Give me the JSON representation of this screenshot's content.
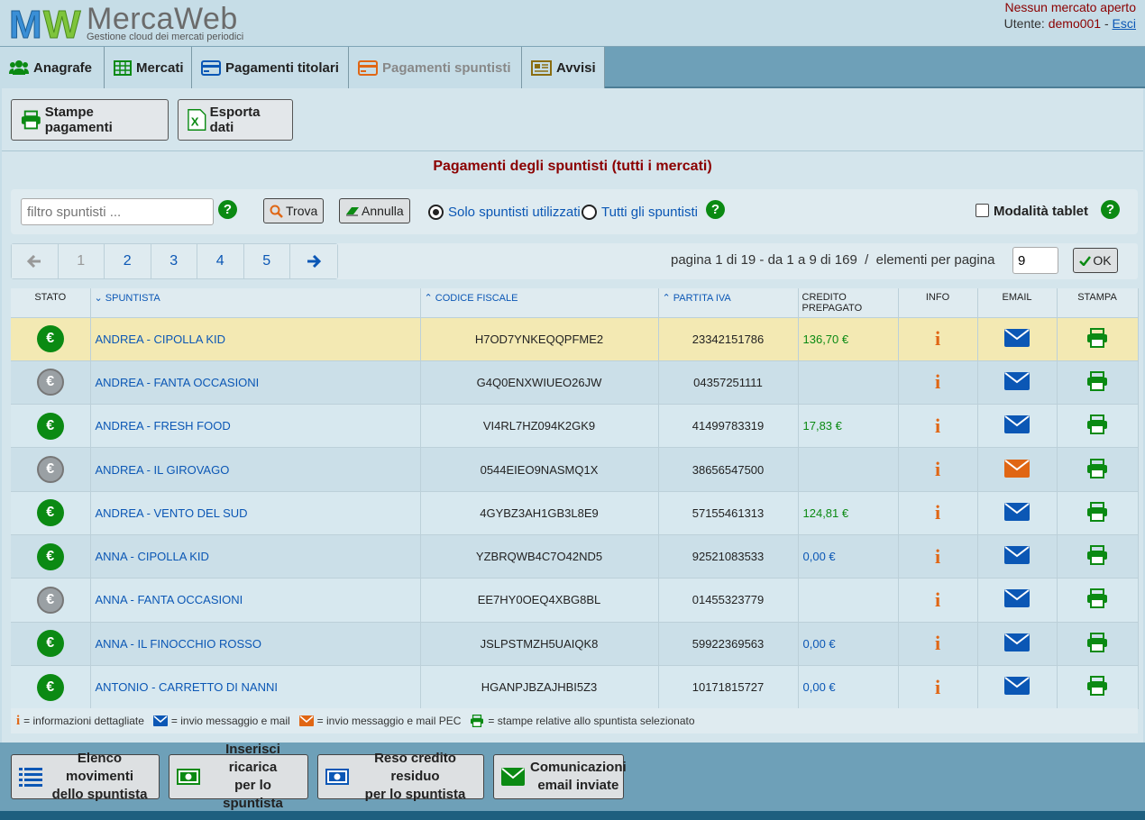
{
  "header": {
    "brand": "MercaWeb",
    "tagline": "Gestione cloud dei mercati periodici",
    "market_status": "Nessun mercato aperto",
    "user_label": "Utente:",
    "username": "demo001",
    "separator": "-",
    "logout": "Esci"
  },
  "nav": {
    "tabs": [
      {
        "label": "Anagrafe",
        "icon": "users-icon"
      },
      {
        "label": "Mercati",
        "icon": "grid-icon"
      },
      {
        "label": "Pagamenti titolari",
        "icon": "credit-card-icon"
      },
      {
        "label": "Pagamenti spuntisti",
        "icon": "credit-card-icon",
        "active": true
      },
      {
        "label": "Avvisi",
        "icon": "newspaper-icon"
      }
    ]
  },
  "toolbar": {
    "print_label": "Stampe pagamenti",
    "export_label": "Esporta dati"
  },
  "page_title": "Pagamenti degli spuntisti (tutti i mercati)",
  "filter": {
    "placeholder": "filtro spuntisti ...",
    "find_label": "Trova",
    "cancel_label": "Annulla",
    "radio_used": "Solo spuntisti utilizzati",
    "radio_all": "Tutti gli spuntisti",
    "tablet_mode": "Modalità tablet",
    "help": "?"
  },
  "pagination": {
    "pages": [
      "1",
      "2",
      "3",
      "4",
      "5"
    ],
    "current_page": "1",
    "info": "pagina 1 di 19 - da 1 a 9 di 169  /  elementi per pagina",
    "per_page": "9",
    "ok_label": "OK"
  },
  "table": {
    "headers": {
      "stato": "STATO",
      "spuntista": "SPUNTISTA",
      "codice_fiscale": "CODICE FISCALE",
      "partita_iva": "PARTITA IVA",
      "credito_1": "CREDITO",
      "credito_2": "PREPAGATO",
      "info": "INFO",
      "email": "EMAIL",
      "stampa": "STAMPA"
    },
    "rows": [
      {
        "stato": "active",
        "name": "ANDREA - CIPOLLA KID",
        "cf": "H7OD7YNKEQQPFME2",
        "piva": "23342151786",
        "credit": "136,70 €",
        "credit_type": "pos",
        "email": "normal",
        "selected": true
      },
      {
        "stato": "inactive",
        "name": "ANDREA - FANTA OCCASIONI",
        "cf": "G4Q0ENXWIUEO26JW",
        "piva": "04357251111",
        "credit": "",
        "credit_type": "",
        "email": "normal"
      },
      {
        "stato": "active",
        "name": "ANDREA - FRESH FOOD",
        "cf": "VI4RL7HZ094K2GK9",
        "piva": "41499783319",
        "credit": "17,83 €",
        "credit_type": "pos",
        "email": "normal"
      },
      {
        "stato": "inactive",
        "name": "ANDREA - IL GIROVAGO",
        "cf": "0544EIEO9NASMQ1X",
        "piva": "38656547500",
        "credit": "",
        "credit_type": "",
        "email": "pec"
      },
      {
        "stato": "active",
        "name": "ANDREA - VENTO DEL SUD",
        "cf": "4GYBZ3AH1GB3L8E9",
        "piva": "57155461313",
        "credit": "124,81 €",
        "credit_type": "pos",
        "email": "normal"
      },
      {
        "stato": "active",
        "name": "ANNA - CIPOLLA KID",
        "cf": "YZBRQWB4C7O42ND5",
        "piva": "92521083533",
        "credit": "0,00 €",
        "credit_type": "zero",
        "email": "normal"
      },
      {
        "stato": "inactive",
        "name": "ANNA - FANTA OCCASIONI",
        "cf": "EE7HY0OEQ4XBG8BL",
        "piva": "01455323779",
        "credit": "",
        "credit_type": "",
        "email": "normal"
      },
      {
        "stato": "active",
        "name": "ANNA - IL FINOCCHIO ROSSO",
        "cf": "JSLPSTMZH5UAIQK8",
        "piva": "59922369563",
        "credit": "0,00 €",
        "credit_type": "zero",
        "email": "normal"
      },
      {
        "stato": "active",
        "name": "ANTONIO - CARRETTO DI NANNI",
        "cf": "HGANPJBZAJHBI5Z3",
        "piva": "10171815727",
        "credit": "0,00 €",
        "credit_type": "zero",
        "email": "normal"
      }
    ]
  },
  "legend": {
    "info": "= informazioni dettagliate",
    "mail": "= invio messaggio e mail",
    "pec": "= invio messaggio e mail PEC",
    "print": "= stampe relative allo spuntista selezionato"
  },
  "footer": {
    "movements_1": "Elenco movimenti",
    "movements_2": "dello spuntista",
    "recharge_1": "Inserisci ricarica",
    "recharge_2": "per lo spuntista",
    "refund_1": "Reso credito residuo",
    "refund_2": "per lo spuntista",
    "emails_1": "Comunicazioni",
    "emails_2": "email inviate"
  },
  "colors": {
    "accent_blue": "#0b57b5",
    "green": "#0b8a13",
    "orange": "#e06614",
    "dark_red": "#8b0000",
    "selected_row": "#f3e9b3"
  }
}
